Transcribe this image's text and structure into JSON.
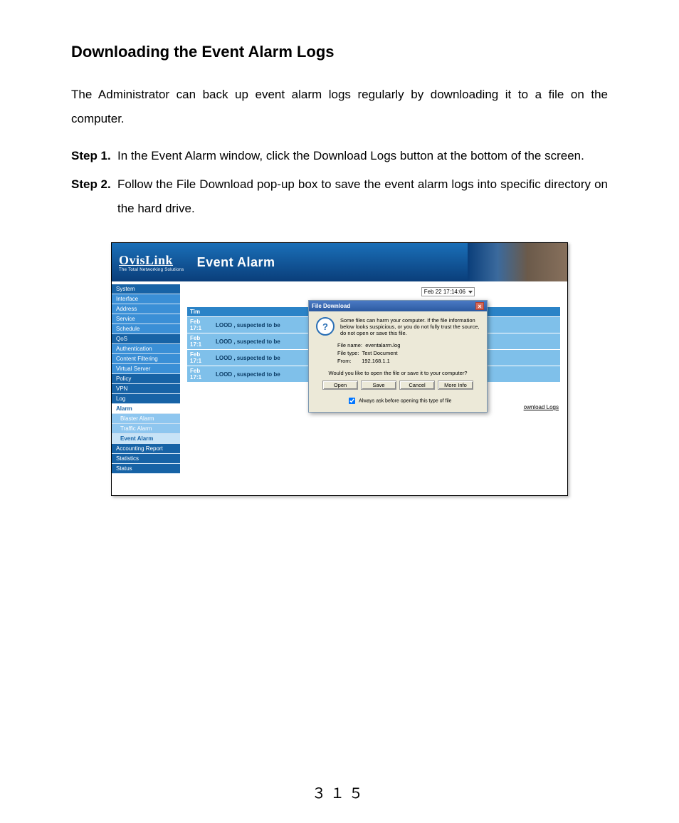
{
  "doc": {
    "heading": "Downloading the Event Alarm Logs",
    "intro": "The Administrator can back up event alarm logs regularly by downloading it to a file on the computer.",
    "steps": [
      {
        "label": "Step 1.",
        "text": "In the Event Alarm window, click the Download Logs button at the bottom of the screen."
      },
      {
        "label": "Step 2.",
        "text": "Follow the File Download pop-up box to save the event alarm logs into specific directory on the hard drive."
      }
    ],
    "page_number": "３１５"
  },
  "app": {
    "brand_name": "OvisLink",
    "brand_tag": "The Total Networking Solutions",
    "section_title": "Event Alarm",
    "date_dropdown": "Feb 22 17:14:06",
    "sidebar": [
      {
        "label": "System",
        "cls": "dark"
      },
      {
        "label": "Interface",
        "cls": ""
      },
      {
        "label": "Address",
        "cls": ""
      },
      {
        "label": "Service",
        "cls": ""
      },
      {
        "label": "Schedule",
        "cls": ""
      },
      {
        "label": "QoS",
        "cls": "dark"
      },
      {
        "label": "Authentication",
        "cls": ""
      },
      {
        "label": "Content Filtering",
        "cls": ""
      },
      {
        "label": "Virtual Server",
        "cls": ""
      },
      {
        "label": "Policy",
        "cls": "dark"
      },
      {
        "label": "VPN",
        "cls": "dark"
      },
      {
        "label": "Log",
        "cls": "dark"
      },
      {
        "label": "Alarm",
        "cls": "active"
      },
      {
        "label": "Blaster Alarm",
        "cls": "sub"
      },
      {
        "label": "Traffic Alarm",
        "cls": "sub"
      },
      {
        "label": "Event Alarm",
        "cls": "active-sub"
      },
      {
        "label": "Accounting Report",
        "cls": "dark"
      },
      {
        "label": "Statistics",
        "cls": "dark"
      },
      {
        "label": "Status",
        "cls": "dark"
      }
    ],
    "log_header": "Tim",
    "log_rows": [
      {
        "t1": "Feb",
        "t2": "17:1",
        "msg": "LOOD , suspected to be"
      },
      {
        "t1": "Feb",
        "t2": "17:1",
        "msg": "LOOD , suspected to be"
      },
      {
        "t1": "Feb",
        "t2": "17:1",
        "msg": "LOOD , suspected to be"
      },
      {
        "t1": "Feb",
        "t2": "17:1",
        "msg": "LOOD , suspected to be"
      }
    ],
    "download_logs": "ownload Logs"
  },
  "dialog": {
    "title": "File Download",
    "close": "×",
    "icon": "?",
    "message": "Some files can harm your computer. If the file information below looks suspicious, or you do not fully trust the source, do not open or save this file.",
    "fields": {
      "name_label": "File name:",
      "name_value": "eventalarm.log",
      "type_label": "File type:",
      "type_value": "Text Document",
      "from_label": "From:",
      "from_value": "192.168.1.1"
    },
    "ask": "Would you like to open the file or save it to your computer?",
    "buttons": {
      "open": "Open",
      "save": "Save",
      "cancel": "Cancel",
      "more": "More Info"
    },
    "checkbox_label": "Always ask before opening this type of file"
  }
}
